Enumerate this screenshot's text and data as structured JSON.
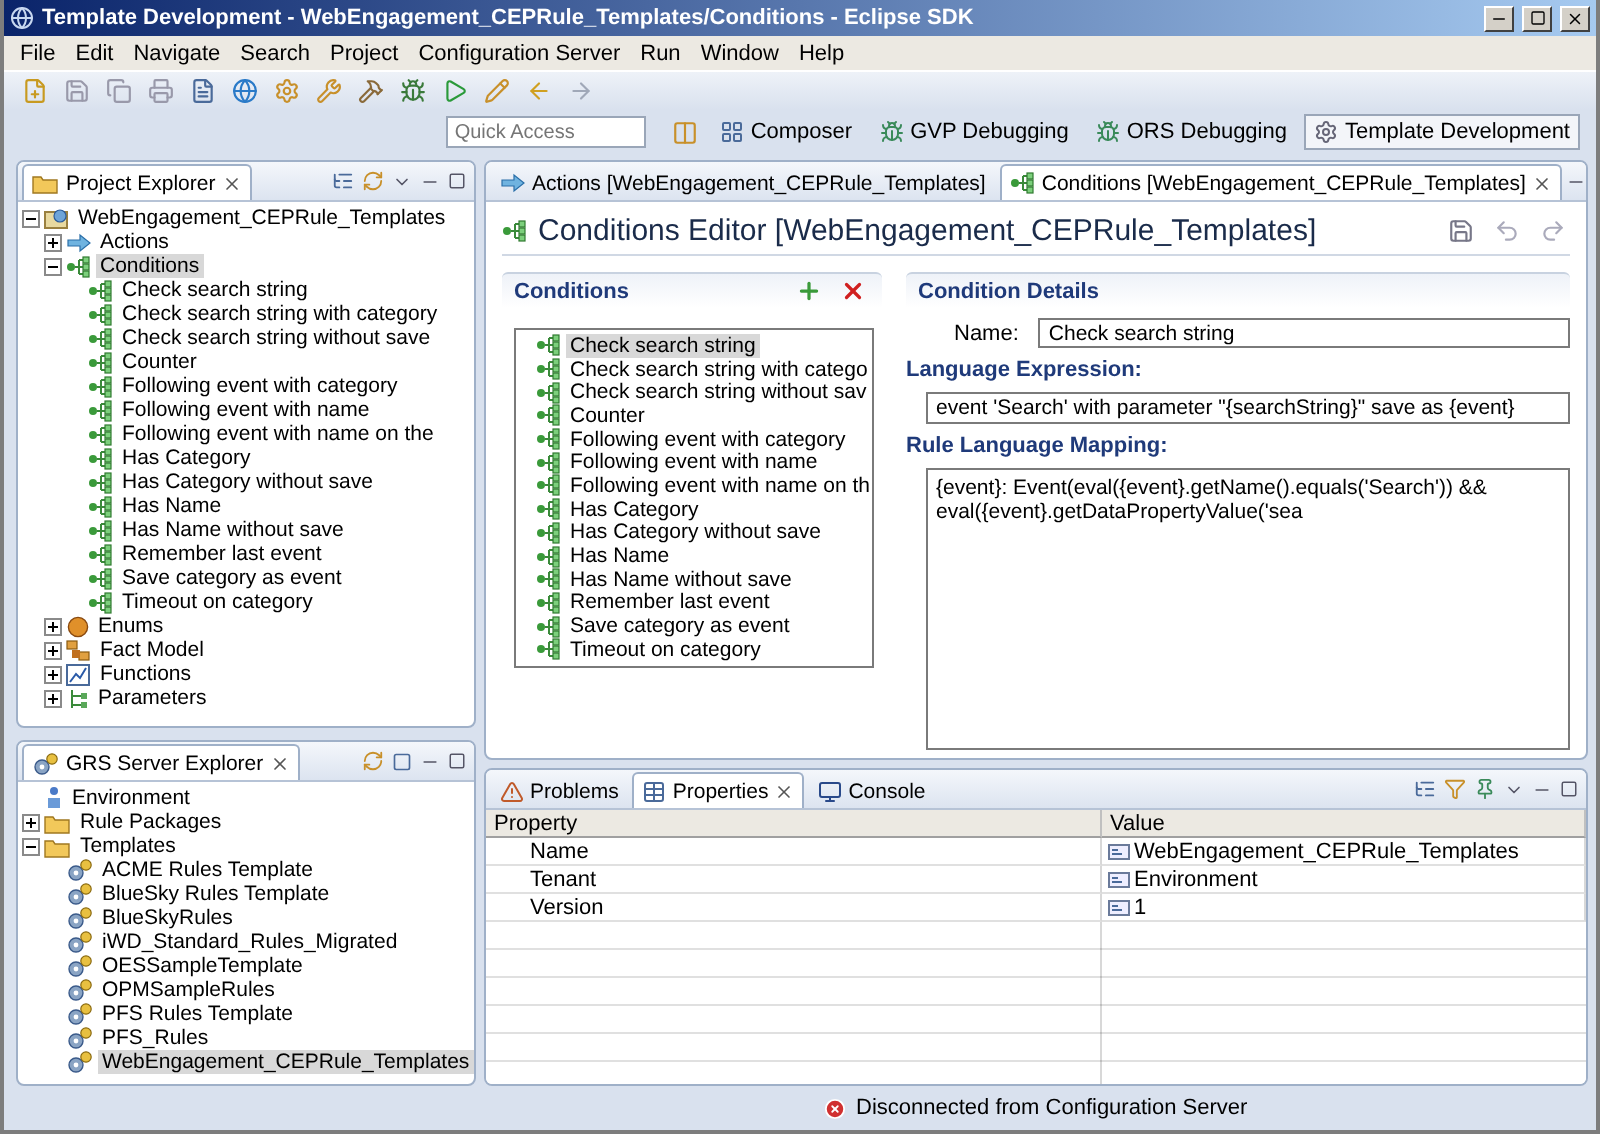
{
  "window": {
    "title": "Template Development - WebEngagement_CEPRule_Templates/Conditions - Eclipse SDK"
  },
  "menu": [
    "File",
    "Edit",
    "Navigate",
    "Search",
    "Project",
    "Configuration Server",
    "Run",
    "Window",
    "Help"
  ],
  "quick_access": {
    "placeholder": "Quick Access"
  },
  "perspectives": [
    {
      "label": "Composer",
      "kind": "grid",
      "selected": false
    },
    {
      "label": "GVP Debugging",
      "kind": "debug",
      "selected": false
    },
    {
      "label": "ORS Debugging",
      "kind": "debug",
      "selected": false
    },
    {
      "label": "Template Development",
      "kind": "template",
      "selected": true
    }
  ],
  "project_explorer": {
    "title": "Project Explorer",
    "tree": [
      {
        "label": "WebEngagement_CEPRule_Templates",
        "kind": "project",
        "expanded": true,
        "selected": false,
        "children": [
          {
            "label": "Actions",
            "kind": "actions",
            "expanded": false,
            "selected": false
          },
          {
            "label": "Conditions",
            "kind": "condition",
            "expanded": true,
            "selected": true,
            "children": [
              {
                "label": "Check search string",
                "kind": "condition",
                "selected": false
              },
              {
                "label": "Check search string with category",
                "kind": "condition",
                "selected": false
              },
              {
                "label": "Check search string without save",
                "kind": "condition",
                "selected": false
              },
              {
                "label": "Counter",
                "kind": "condition",
                "selected": false
              },
              {
                "label": "Following event with category",
                "kind": "condition",
                "selected": false
              },
              {
                "label": "Following event with name",
                "kind": "condition",
                "selected": false
              },
              {
                "label": "Following event with name on the",
                "kind": "condition",
                "selected": false
              },
              {
                "label": "Has Category",
                "kind": "condition",
                "selected": false
              },
              {
                "label": "Has Category without save",
                "kind": "condition",
                "selected": false
              },
              {
                "label": "Has Name",
                "kind": "condition",
                "selected": false
              },
              {
                "label": "Has Name without save",
                "kind": "condition",
                "selected": false
              },
              {
                "label": "Remember last event",
                "kind": "condition",
                "selected": false
              },
              {
                "label": "Save category as event",
                "kind": "condition",
                "selected": false
              },
              {
                "label": "Timeout on category",
                "kind": "condition",
                "selected": false
              }
            ]
          },
          {
            "label": "Enums",
            "kind": "enums",
            "expanded": false,
            "selected": false
          },
          {
            "label": "Fact Model",
            "kind": "factmodel",
            "expanded": false,
            "selected": false
          },
          {
            "label": "Functions",
            "kind": "functions",
            "expanded": false,
            "selected": false
          },
          {
            "label": "Parameters",
            "kind": "parameters",
            "expanded": false,
            "selected": false
          }
        ]
      }
    ]
  },
  "grs_explorer": {
    "title": "GRS Server Explorer",
    "tree": [
      {
        "label": "Environment",
        "kind": "environment",
        "selected": false
      },
      {
        "label": "Rule Packages",
        "kind": "folder",
        "expanded": false,
        "selected": false
      },
      {
        "label": "Templates",
        "kind": "folder",
        "expanded": true,
        "selected": false,
        "children": [
          {
            "label": "ACME Rules Template",
            "kind": "template",
            "selected": false
          },
          {
            "label": "BlueSky Rules Template",
            "kind": "template",
            "selected": false
          },
          {
            "label": "BlueSkyRules",
            "kind": "template",
            "selected": false
          },
          {
            "label": "iWD_Standard_Rules_Migrated",
            "kind": "template",
            "selected": false
          },
          {
            "label": "OESSampleTemplate",
            "kind": "template",
            "selected": false
          },
          {
            "label": "OPMSampleRules",
            "kind": "template",
            "selected": false
          },
          {
            "label": "PFS Rules Template",
            "kind": "template",
            "selected": false
          },
          {
            "label": "PFS_Rules",
            "kind": "template",
            "selected": false
          },
          {
            "label": "WebEngagement_CEPRule_Templates",
            "kind": "template",
            "selected": true
          }
        ]
      }
    ]
  },
  "editor": {
    "tabs": [
      {
        "label": "Actions [WebEngagement_CEPRule_Templates]",
        "kind": "actions",
        "selected": false
      },
      {
        "label": "Conditions [WebEngagement_CEPRule_Templates]",
        "kind": "condition",
        "selected": true
      }
    ],
    "title": "Conditions Editor [WebEngagement_CEPRule_Templates]",
    "conditions": {
      "heading": "Conditions",
      "items": [
        {
          "label": "Check search string",
          "selected": true
        },
        {
          "label": "Check search string with catego",
          "selected": false
        },
        {
          "label": "Check search string without sav",
          "selected": false
        },
        {
          "label": "Counter",
          "selected": false
        },
        {
          "label": "Following event with category",
          "selected": false
        },
        {
          "label": "Following event with name",
          "selected": false
        },
        {
          "label": "Following event with name on th",
          "selected": false
        },
        {
          "label": "Has Category",
          "selected": false
        },
        {
          "label": "Has Category without save",
          "selected": false
        },
        {
          "label": "Has Name",
          "selected": false
        },
        {
          "label": "Has Name without save",
          "selected": false
        },
        {
          "label": "Remember last event",
          "selected": false
        },
        {
          "label": "Save category as event",
          "selected": false
        },
        {
          "label": "Timeout on category",
          "selected": false
        }
      ]
    },
    "details": {
      "heading": "Condition Details",
      "name_label": "Name:",
      "name_value": "Check search string",
      "expression_heading": "Language Expression:",
      "expression": "event 'Search' with parameter \"{searchString}\" save as {event}",
      "mapping_heading": "Rule Language Mapping:",
      "mapping": "{event}: Event(eval({event}.getName().equals('Search')) && eval({event}.getDataPropertyValue('sea"
    }
  },
  "bottom_panel": {
    "tabs": [
      {
        "label": "Problems",
        "kind": "problems",
        "selected": false
      },
      {
        "label": "Properties",
        "kind": "properties",
        "selected": true
      },
      {
        "label": "Console",
        "kind": "console",
        "selected": false
      }
    ],
    "columns": [
      "Property",
      "Value"
    ],
    "rows": [
      {
        "property": "Name",
        "value": "WebEngagement_CEPRule_Templates"
      },
      {
        "property": "Tenant",
        "value": "Environment"
      },
      {
        "property": "Version",
        "value": "1"
      }
    ]
  },
  "status_bar": {
    "message": "Disconnected from Configuration Server"
  }
}
